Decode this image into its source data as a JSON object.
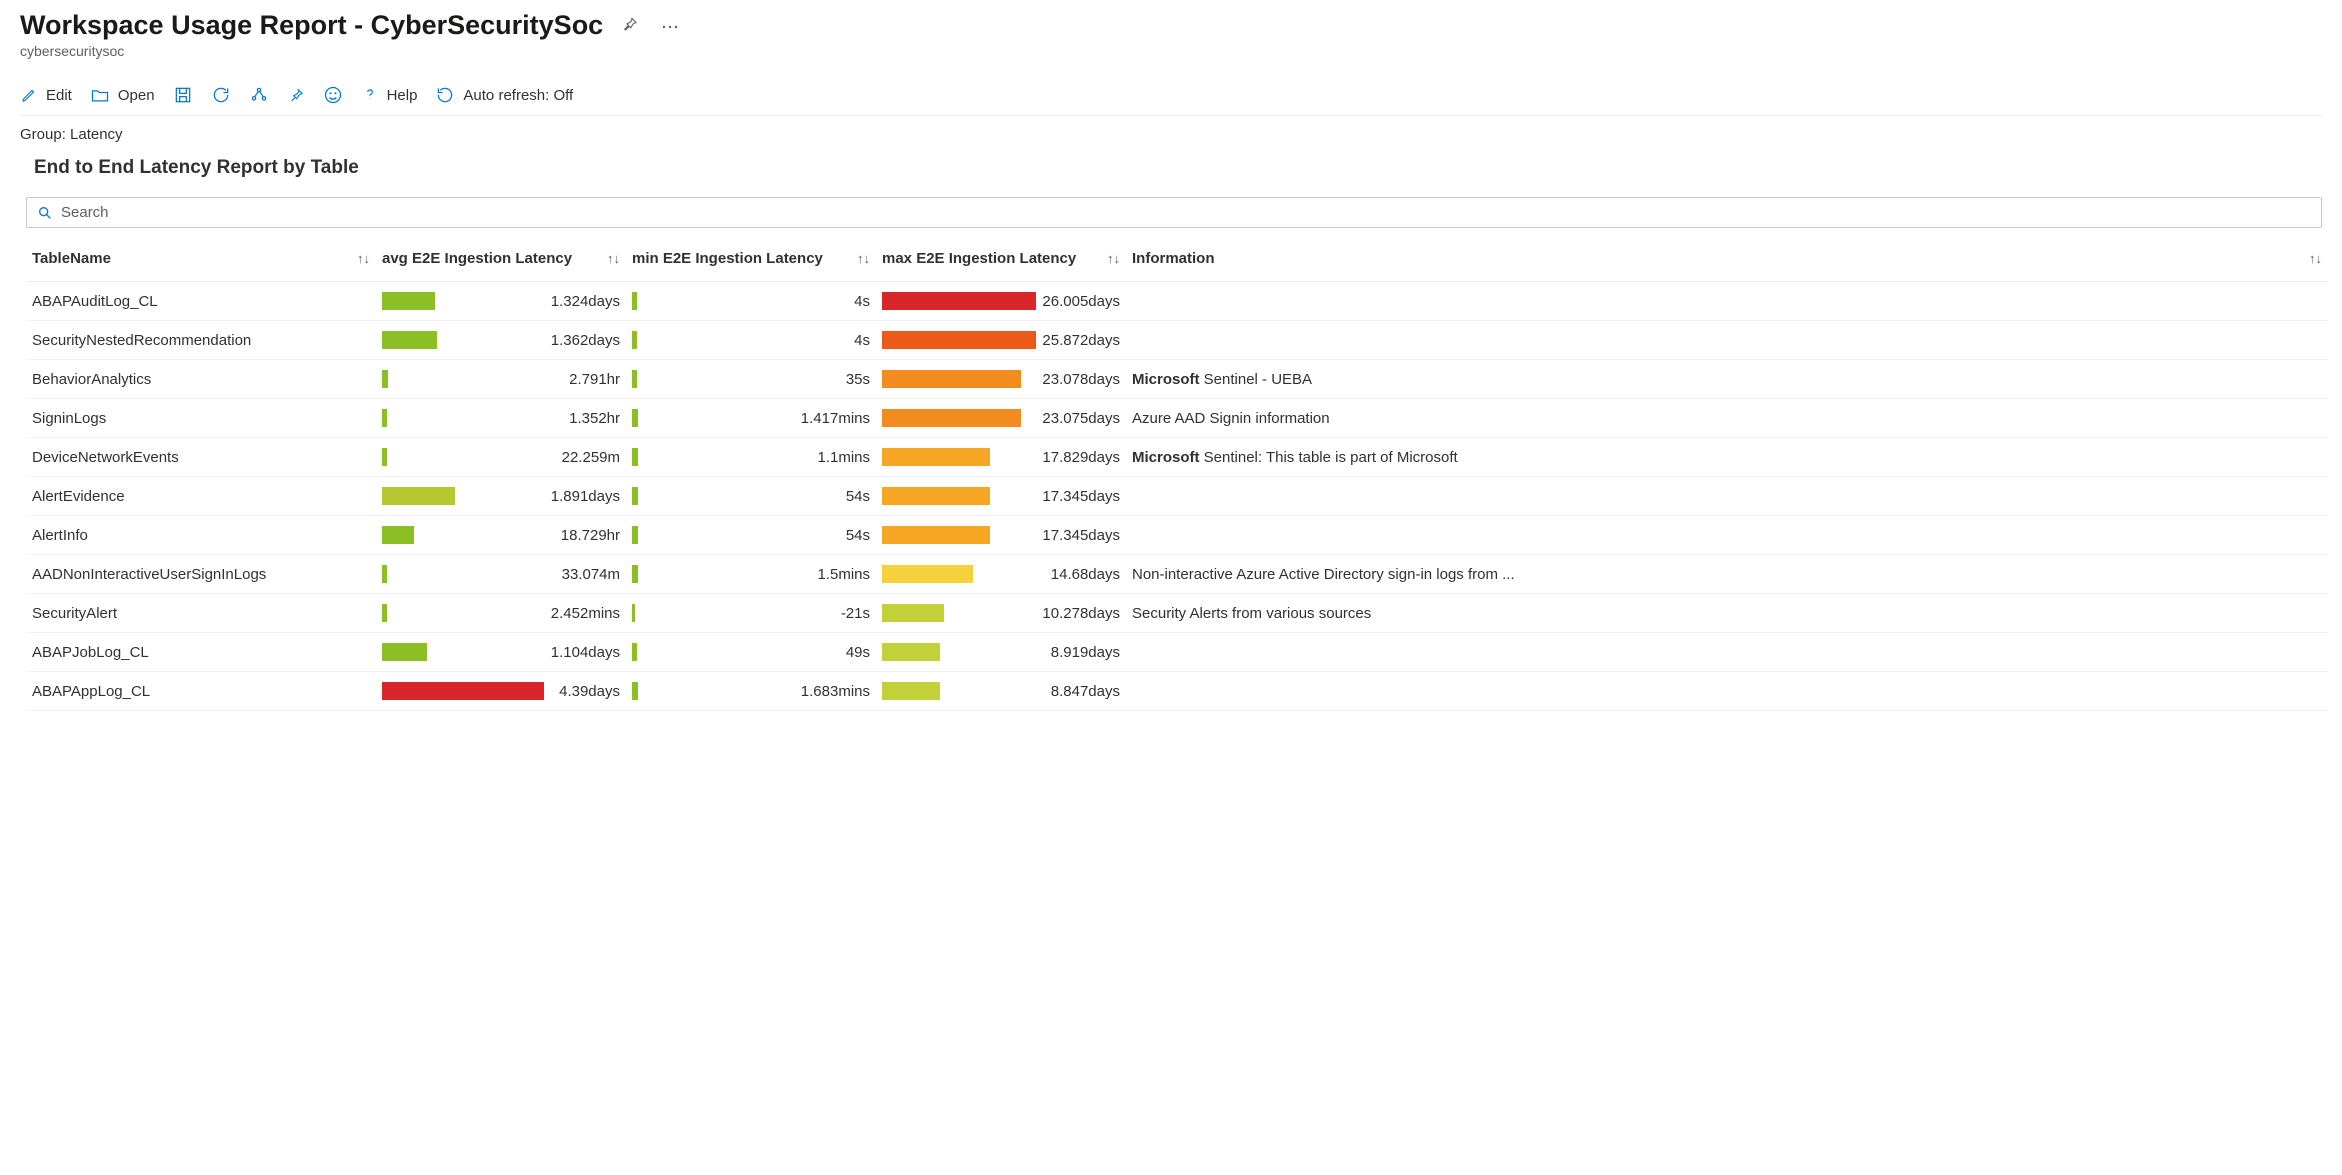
{
  "header": {
    "title": "Workspace Usage Report - CyberSecuritySoc",
    "subtitle": "cybersecuritysoc"
  },
  "toolbar": {
    "edit": "Edit",
    "open": "Open",
    "help": "Help",
    "auto_refresh": "Auto refresh: Off"
  },
  "group_label": "Group: Latency",
  "section_title": "End to End Latency Report by Table",
  "search_placeholder": "Search",
  "columns": {
    "name": "TableName",
    "avg": "avg E2E Ingestion Latency",
    "min": "min E2E Ingestion Latency",
    "max": "max E2E Ingestion Latency",
    "info": "Information"
  },
  "rows": [
    {
      "name": "ABAPAuditLog_CL",
      "avg_v": "1.324days",
      "avg_w": 33,
      "avg_c": "#8cbf26",
      "min_v": "4s",
      "min_w": 3,
      "min_c": "#8cbf26",
      "max_v": "26.005days",
      "max_w": 100,
      "max_c": "#d9262a",
      "info": ""
    },
    {
      "name": "SecurityNestedRecommendation",
      "avg_v": "1.362days",
      "avg_w": 34,
      "avg_c": "#8cbf26",
      "min_v": "4s",
      "min_w": 3,
      "min_c": "#8cbf26",
      "max_v": "25.872days",
      "max_w": 100,
      "max_c": "#ec5a1a",
      "info": ""
    },
    {
      "name": "BehaviorAnalytics",
      "avg_v": "2.791hr",
      "avg_w": 4,
      "avg_c": "#8cbf26",
      "min_v": "35s",
      "min_w": 3,
      "min_c": "#8cbf26",
      "max_v": "23.078days",
      "max_w": 90,
      "max_c": "#f28c1e",
      "info_strong": "Microsoft",
      "info": " Sentinel - UEBA"
    },
    {
      "name": "SigninLogs",
      "avg_v": "1.352hr",
      "avg_w": 3,
      "avg_c": "#8cbf26",
      "min_v": "1.417mins",
      "min_w": 4,
      "min_c": "#8cbf26",
      "max_v": "23.075days",
      "max_w": 90,
      "max_c": "#f28c1e",
      "info": "Azure AAD Signin information"
    },
    {
      "name": "DeviceNetworkEvents",
      "avg_v": "22.259m",
      "avg_w": 3,
      "avg_c": "#8cbf26",
      "min_v": "1.1mins",
      "min_w": 4,
      "min_c": "#8cbf26",
      "max_v": "17.829days",
      "max_w": 70,
      "max_c": "#f5a623",
      "info_strong": "Microsoft",
      "info": " Sentinel: This table is part of Microsoft"
    },
    {
      "name": "AlertEvidence",
      "avg_v": "1.891days",
      "avg_w": 45,
      "avg_c": "#b5c831",
      "min_v": "54s",
      "min_w": 4,
      "min_c": "#8cbf26",
      "max_v": "17.345days",
      "max_w": 70,
      "max_c": "#f5a623",
      "info": ""
    },
    {
      "name": "AlertInfo",
      "avg_v": "18.729hr",
      "avg_w": 20,
      "avg_c": "#8cbf26",
      "min_v": "54s",
      "min_w": 4,
      "min_c": "#8cbf26",
      "max_v": "17.345days",
      "max_w": 70,
      "max_c": "#f5a623",
      "info": ""
    },
    {
      "name": "AADNonInteractiveUserSignInLogs",
      "avg_v": "33.074m",
      "avg_w": 3,
      "avg_c": "#8cbf26",
      "min_v": "1.5mins",
      "min_w": 4,
      "min_c": "#8cbf26",
      "max_v": "14.68days",
      "max_w": 56,
      "max_c": "#f4d13d",
      "info": "Non-interactive Azure Active Directory sign-in logs from ..."
    },
    {
      "name": "SecurityAlert",
      "avg_v": "2.452mins",
      "avg_w": 3,
      "avg_c": "#8cbf26",
      "min_v": "-21s",
      "min_w": 2,
      "min_c": "#8cbf26",
      "max_v": "10.278days",
      "max_w": 40,
      "max_c": "#c2d13a",
      "info": "Security Alerts from various sources"
    },
    {
      "name": "ABAPJobLog_CL",
      "avg_v": "1.104days",
      "avg_w": 28,
      "avg_c": "#8cbf26",
      "min_v": "49s",
      "min_w": 3,
      "min_c": "#8cbf26",
      "max_v": "8.919days",
      "max_w": 36,
      "max_c": "#c2d13a",
      "info": ""
    },
    {
      "name": "ABAPAppLog_CL",
      "avg_v": "4.39days",
      "avg_w": 100,
      "avg_c": "#d9262a",
      "min_v": "1.683mins",
      "min_w": 4,
      "min_c": "#8cbf26",
      "max_v": "8.847days",
      "max_w": 36,
      "max_c": "#c2d13a",
      "info": ""
    }
  ]
}
